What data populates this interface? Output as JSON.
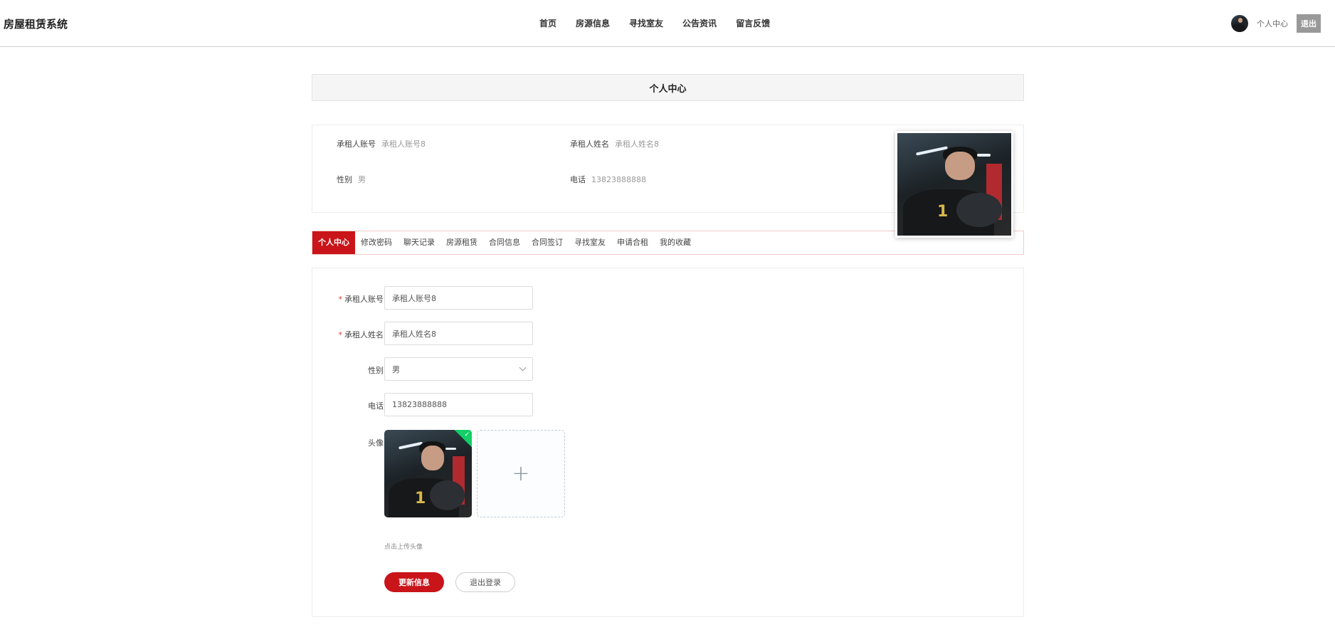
{
  "header": {
    "brand": "房屋租赁系统",
    "nav": [
      "首页",
      "房源信息",
      "寻找室友",
      "公告资讯",
      "留言反馈"
    ],
    "user_center": "个人中心",
    "logout": "退出"
  },
  "page_title": "个人中心",
  "profile": {
    "account_label": "承租人账号",
    "account_value": "承租人账号8",
    "name_label": "承租人姓名",
    "name_value": "承租人姓名8",
    "gender_label": "性别",
    "gender_value": "男",
    "phone_label": "电话",
    "phone_value": "13823888888"
  },
  "tabs": [
    "个人中心",
    "修改密码",
    "聊天记录",
    "房源租赁",
    "合同信息",
    "合同签订",
    "寻找室友",
    "申请合租",
    "我的收藏"
  ],
  "form": {
    "required_mark": "*",
    "account_label": "承租人账号",
    "account_value": "承租人账号8",
    "name_label": "承租人姓名",
    "name_value": "承租人姓名8",
    "gender_label": "性别",
    "gender_value": "男",
    "phone_label": "电话",
    "phone_value": "13823888888",
    "avatar_label": "头像",
    "upload_tip": "点击上传头像",
    "update_button": "更新信息",
    "logout_button": "退出登录"
  },
  "icons": {
    "plus": "plus-icon",
    "check": "check-icon",
    "chevron": "chevron-down-icon"
  },
  "colors": {
    "accent": "#c9141a",
    "success": "#13ce66"
  }
}
